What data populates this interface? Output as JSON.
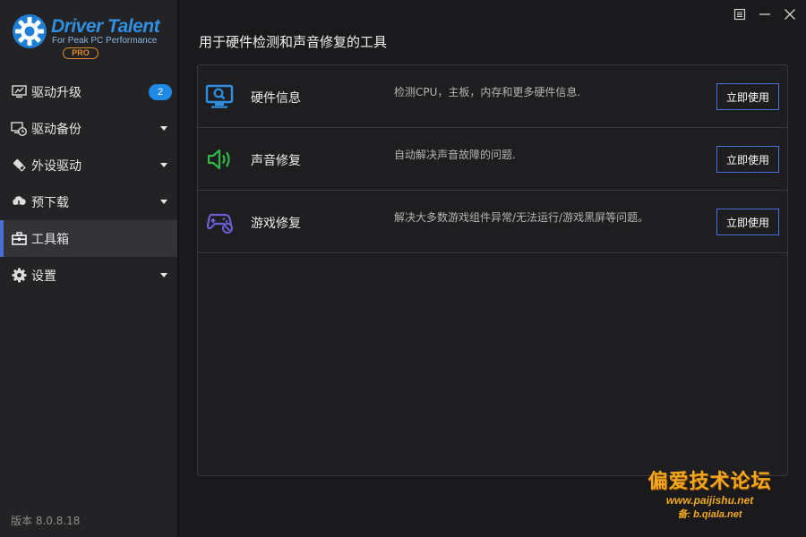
{
  "app": {
    "brand": "Driver Talent",
    "tagline": "For Peak PC Performance",
    "edition": "PRO",
    "version_text": "版本 8.0.8.18"
  },
  "window_controls": [
    "menu-icon",
    "minimize-icon",
    "close-icon"
  ],
  "sidebar": {
    "items": [
      {
        "label": "驱动升级",
        "icon": "monitor-upgrade-icon",
        "badge": "2"
      },
      {
        "label": "驱动备份",
        "icon": "backup-clock-icon"
      },
      {
        "label": "外设驱动",
        "icon": "usb-device-icon"
      },
      {
        "label": "预下载",
        "icon": "cloud-download-icon"
      },
      {
        "label": "工具箱",
        "icon": "toolbox-icon",
        "active": true
      },
      {
        "label": "设置",
        "icon": "gear-icon"
      }
    ]
  },
  "main": {
    "title": "用于硬件检测和声音修复的工具",
    "tools": [
      {
        "name": "硬件信息",
        "description": "检测CPU，主板，内存和更多硬件信息.",
        "button": "立即使用",
        "icon": "hardware-search-icon",
        "color": "#2f8fe0"
      },
      {
        "name": "声音修复",
        "description": "自动解决声音故障的问题.",
        "button": "立即使用",
        "icon": "speaker-icon",
        "color": "#2fb84a"
      },
      {
        "name": "游戏修复",
        "description": "解决大多数游戏组件异常/无法运行/游戏黑屏等问题。",
        "button": "立即使用",
        "icon": "gamepad-icon",
        "color": "#6a5fd8"
      }
    ]
  },
  "watermark": {
    "title": "偏爱技术论坛",
    "url": "www.paijishu.net",
    "url2": "备: b.qiala.net"
  },
  "colors": {
    "accent": "#4a6fd8",
    "badge": "#1e8ae6",
    "brand_blue": "#2f8fe0",
    "pro_orange": "#e08a2a",
    "watermark": "#f2a81d"
  }
}
